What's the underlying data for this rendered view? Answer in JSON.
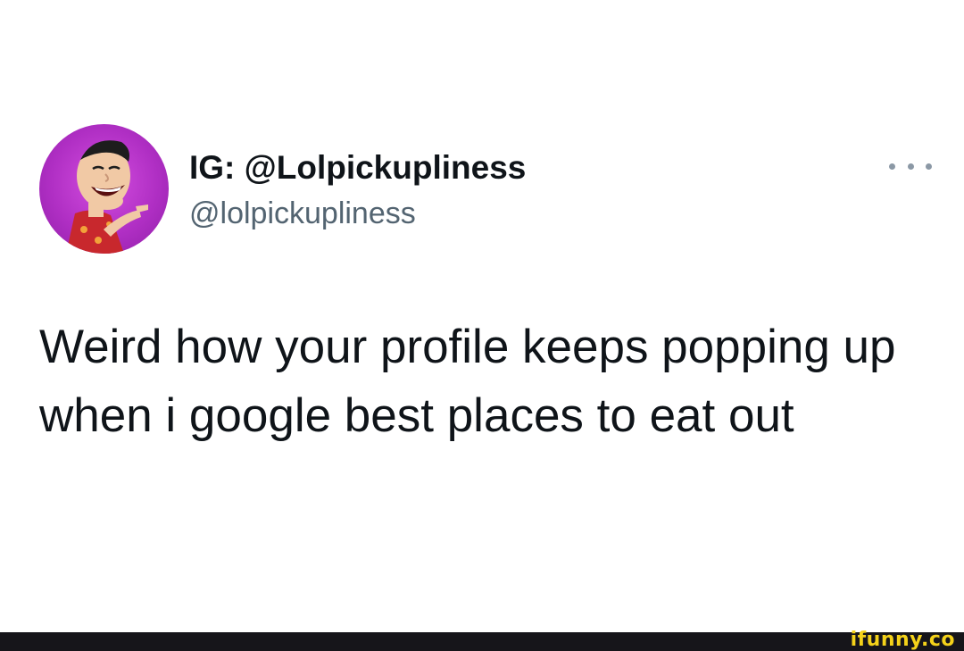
{
  "tweet": {
    "display_name": "IG: @Lolpickupliness",
    "handle": "@lolpickupliness",
    "more_icon": "more-options-icon",
    "text": "Weird how your profile keeps popping up when i google best places to eat out"
  },
  "avatar": {
    "icon": "cartoon-character-avatar",
    "background_color": "#b02fc4"
  },
  "watermark": {
    "text": "ifunny.co",
    "color": "#f4d21a"
  },
  "colors": {
    "name_text": "#0f1419",
    "handle_text": "#536471",
    "footer_bar": "#16151a"
  }
}
